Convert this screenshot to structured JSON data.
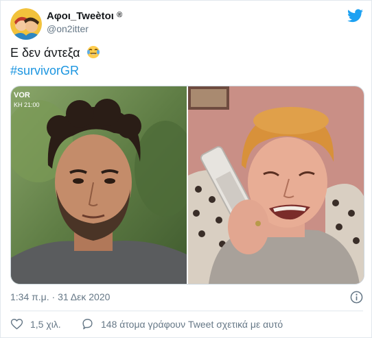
{
  "tweet": {
    "author_name": "Αφοι_Tweètoι",
    "verified_mark": "®",
    "handle": "@on2itter",
    "text_line1": "Ε δεν άντεξα",
    "emoji": "face-with-tears-of-joy",
    "hashtag": "#survivorGR",
    "timestamp": "1:34 π.μ. · 31 Δεκ 2020",
    "likes": "1,5 χιλ.",
    "replies_text": "148 άτομα γράφουν Tweet σχετικά με αυτό",
    "inset_caption": "VOR\nKH 21:00"
  },
  "colors": {
    "text": "#14171a",
    "secondary": "#657786",
    "link": "#1b95e0",
    "brand": "#1da1f2",
    "border": "#e1e8ed"
  },
  "icons": [
    "twitter-bird-icon",
    "info-icon",
    "heart-icon",
    "reply-bubble-icon"
  ]
}
